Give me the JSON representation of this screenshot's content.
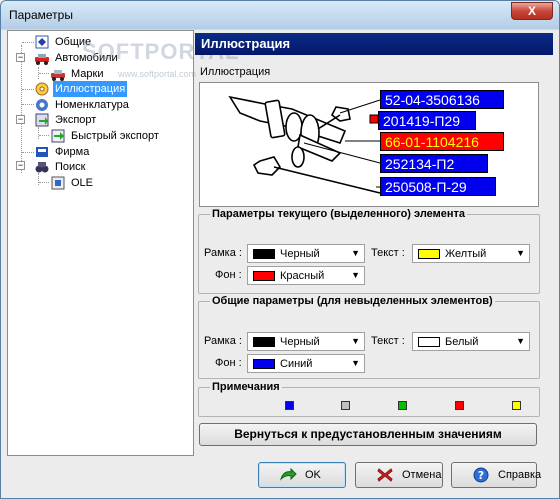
{
  "window": {
    "title": "Параметры",
    "close_label": "X"
  },
  "watermark": {
    "main": "SOFTPORTAL",
    "sub": "www.softportal.com"
  },
  "tree": {
    "items": [
      {
        "label": "Общие"
      },
      {
        "label": "Автомобили"
      },
      {
        "label": "Марки"
      },
      {
        "label": "Иллюстрация"
      },
      {
        "label": "Номенклатура"
      },
      {
        "label": "Экспорт"
      },
      {
        "label": "Быстрый экспорт"
      },
      {
        "label": "Фирма"
      },
      {
        "label": "Поиск"
      },
      {
        "label": "OLE"
      }
    ],
    "selected": "Иллюстрация"
  },
  "header": {
    "title": "Иллюстрация"
  },
  "illustration": {
    "group_label": "Иллюстрация",
    "codes": [
      "52-04-3506136",
      "201419-П29",
      "66-01-1104216",
      "252134-П2",
      "250508-П-29"
    ]
  },
  "current_params": {
    "title": "Параметры текущего (выделенного) элемента",
    "frame_label": "Рамка :",
    "frame_value": "Черный",
    "text_label": "Текст :",
    "text_value": "Желтый",
    "bg_label": "Фон :",
    "bg_value": "Красный"
  },
  "common_params": {
    "title": "Общие параметры (для невыделенных элементов)",
    "frame_label": "Рамка :",
    "frame_value": "Черный",
    "text_label": "Текст :",
    "text_value": "Белый",
    "bg_label": "Фон :",
    "bg_value": "Синий"
  },
  "notes": {
    "title": "Примечания",
    "colors": [
      "#0000ee",
      "#c0c0c0",
      "#00c000",
      "#ff0000",
      "#ffff00"
    ]
  },
  "colors": {
    "black": "#000000",
    "yellow": "#ffff00",
    "red": "#ff0000",
    "white": "#ffffff",
    "blue": "#0000ee",
    "header_blue": "#04166a",
    "selection": "#3399ff"
  },
  "buttons": {
    "reset": "Вернуться к предустановленным значениям",
    "ok": "OK",
    "cancel": "Отмена",
    "help": "Справка"
  }
}
